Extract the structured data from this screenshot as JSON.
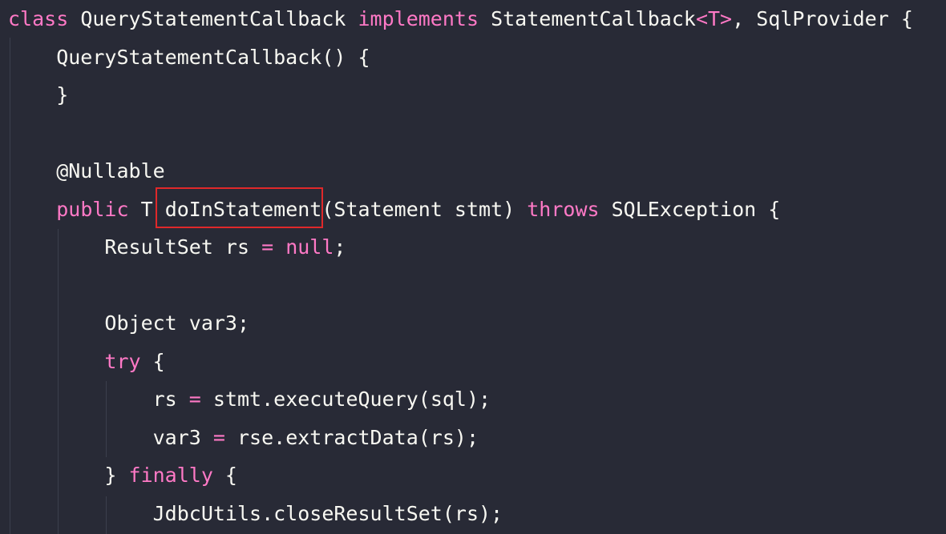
{
  "editor": {
    "theme_colors": {
      "background": "#282a36",
      "foreground": "#f8f8f2",
      "keyword": "#ff79c6",
      "indent_guide": "#3c3f4d",
      "highlight_box": "#e0282a"
    },
    "lines": [
      {
        "tokens": [
          {
            "text": "class",
            "type": "keyword"
          },
          {
            "text": " QueryStatementCallback ",
            "type": "plain"
          },
          {
            "text": "implements",
            "type": "keyword"
          },
          {
            "text": " StatementCallback",
            "type": "plain"
          },
          {
            "text": "<T>",
            "type": "keyword"
          },
          {
            "text": ", SqlProvider {",
            "type": "plain"
          }
        ]
      },
      {
        "tokens": [
          {
            "text": "    QueryStatementCallback() {",
            "type": "plain"
          }
        ]
      },
      {
        "tokens": [
          {
            "text": "    }",
            "type": "plain"
          }
        ]
      },
      {
        "tokens": []
      },
      {
        "tokens": [
          {
            "text": "    @Nullable",
            "type": "plain"
          }
        ]
      },
      {
        "tokens": [
          {
            "text": "    ",
            "type": "plain"
          },
          {
            "text": "public",
            "type": "keyword"
          },
          {
            "text": " T ",
            "type": "plain"
          },
          {
            "text": "doInStatement",
            "type": "plain",
            "highlighted": true
          },
          {
            "text": "(Statement stmt) ",
            "type": "plain"
          },
          {
            "text": "throws",
            "type": "keyword"
          },
          {
            "text": " SQLException {",
            "type": "plain"
          }
        ]
      },
      {
        "tokens": [
          {
            "text": "        ResultSet rs ",
            "type": "plain"
          },
          {
            "text": "=",
            "type": "keyword"
          },
          {
            "text": " ",
            "type": "plain"
          },
          {
            "text": "null",
            "type": "keyword"
          },
          {
            "text": ";",
            "type": "plain"
          }
        ]
      },
      {
        "tokens": []
      },
      {
        "tokens": [
          {
            "text": "        Object var3;",
            "type": "plain"
          }
        ]
      },
      {
        "tokens": [
          {
            "text": "        ",
            "type": "plain"
          },
          {
            "text": "try",
            "type": "keyword"
          },
          {
            "text": " {",
            "type": "plain"
          }
        ]
      },
      {
        "tokens": [
          {
            "text": "            rs ",
            "type": "plain"
          },
          {
            "text": "=",
            "type": "keyword"
          },
          {
            "text": " stmt.executeQuery(sql);",
            "type": "plain"
          }
        ]
      },
      {
        "tokens": [
          {
            "text": "            var3 ",
            "type": "plain"
          },
          {
            "text": "=",
            "type": "keyword"
          },
          {
            "text": " rse.extractData(rs);",
            "type": "plain"
          }
        ]
      },
      {
        "tokens": [
          {
            "text": "        } ",
            "type": "plain"
          },
          {
            "text": "finally",
            "type": "keyword"
          },
          {
            "text": " {",
            "type": "plain"
          }
        ]
      },
      {
        "tokens": [
          {
            "text": "            JdbcUtils.closeResultSet(rs);",
            "type": "plain"
          }
        ]
      }
    ]
  }
}
